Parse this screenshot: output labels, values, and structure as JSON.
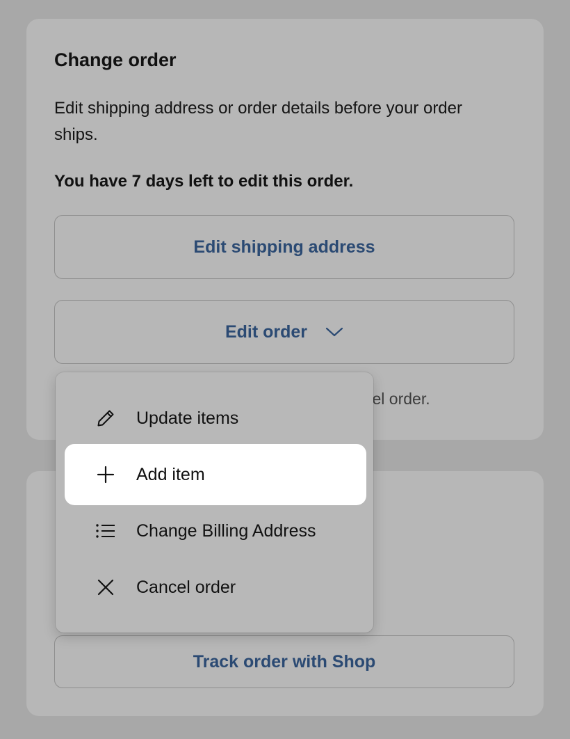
{
  "change_order": {
    "title": "Change order",
    "description": "Edit shipping address or order details before your order ships.",
    "days_left": "You have 7 days left to edit this order.",
    "edit_shipping_label": "Edit shipping address",
    "edit_order_label": "Edit order",
    "cancel_note_partial": "cel order."
  },
  "menu": {
    "items": [
      {
        "label": "Update items",
        "icon": "pencil-icon"
      },
      {
        "label": "Add item",
        "icon": "plus-icon",
        "highlighted": true
      },
      {
        "label": "Change Billing Address",
        "icon": "list-icon"
      },
      {
        "label": "Cancel order",
        "icon": "close-icon"
      }
    ]
  },
  "track": {
    "button_label": "Track order with Shop"
  },
  "colors": {
    "page_background": "#a8a8a8",
    "card_background": "#b7b7b7",
    "button_text": "#2b4a73",
    "highlight": "#ffffff"
  }
}
